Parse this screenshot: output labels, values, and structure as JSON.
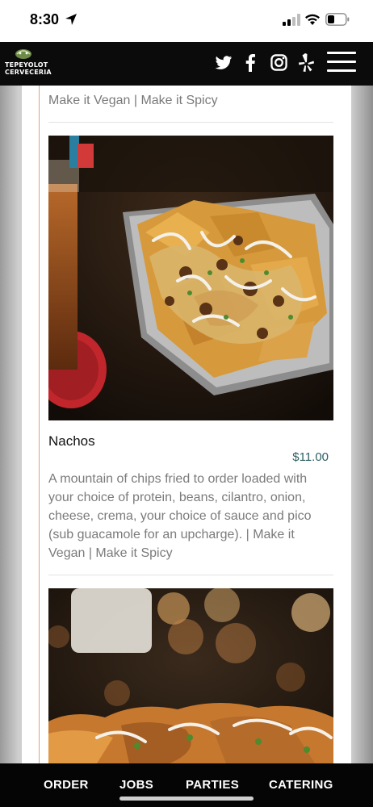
{
  "status_bar": {
    "time": "8:30"
  },
  "header": {
    "logo_line_1": "TEPEYOLOT",
    "logo_line_2": "CERVECERIA",
    "social_icons": [
      "twitter-icon",
      "facebook-icon",
      "instagram-icon",
      "yelp-icon"
    ],
    "menu_icon": "hamburger-icon"
  },
  "menu": {
    "previous_item_tail": "Make it Vegan | Make it Spicy",
    "item": {
      "name": "Nachos",
      "price": "$11.00",
      "description": "A mountain of chips fried to order loaded with your choice of protein, beans, cilantro, onion, cheese, crema, your choice of sauce and pico (sub guacamole for an upcharge). | Make it Vegan | Make it Spicy"
    }
  },
  "bottom_nav": {
    "items": [
      "ORDER",
      "JOBS",
      "PARTIES",
      "CATERING"
    ]
  },
  "colors": {
    "header_bg": "#0b0b0b",
    "price": "#2f5f63",
    "accent_rule": "#e0a27e"
  }
}
